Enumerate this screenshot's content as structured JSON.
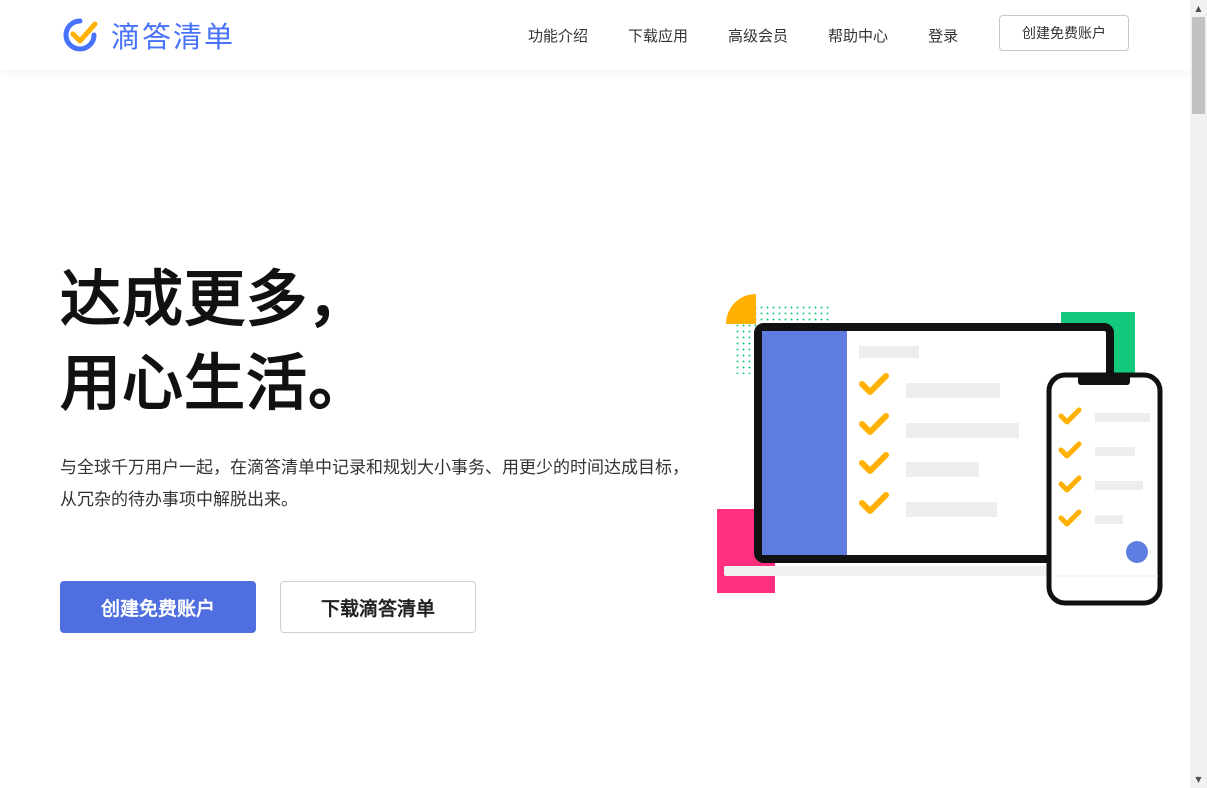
{
  "brand": {
    "name": "滴答清单",
    "accent": "#4772fa",
    "check_color": "#ffb000"
  },
  "nav": {
    "items": [
      {
        "label": "功能介绍",
        "name": "nav-item-features"
      },
      {
        "label": "下载应用",
        "name": "nav-item-download"
      },
      {
        "label": "高级会员",
        "name": "nav-item-premium"
      },
      {
        "label": "帮助中心",
        "name": "nav-item-help"
      },
      {
        "label": "登录",
        "name": "nav-item-login"
      }
    ],
    "signup_label": "创建免费账户"
  },
  "hero": {
    "title_line1": "达成更多，",
    "title_line2": "用心生活。",
    "description": "与全球千万用户一起，在滴答清单中记录和规划大小事务、用更少的时间达成目标，从冗杂的待办事项中解脱出来。",
    "primary_button": "创建免费账户",
    "secondary_button": "下载滴答清单",
    "primary_color": "#4f6fe0"
  },
  "illustration": {
    "colors": {
      "sidebar": "#5f7de0",
      "green": "#13c97b",
      "pink": "#ff2e7e",
      "yellow": "#ffb000"
    }
  }
}
